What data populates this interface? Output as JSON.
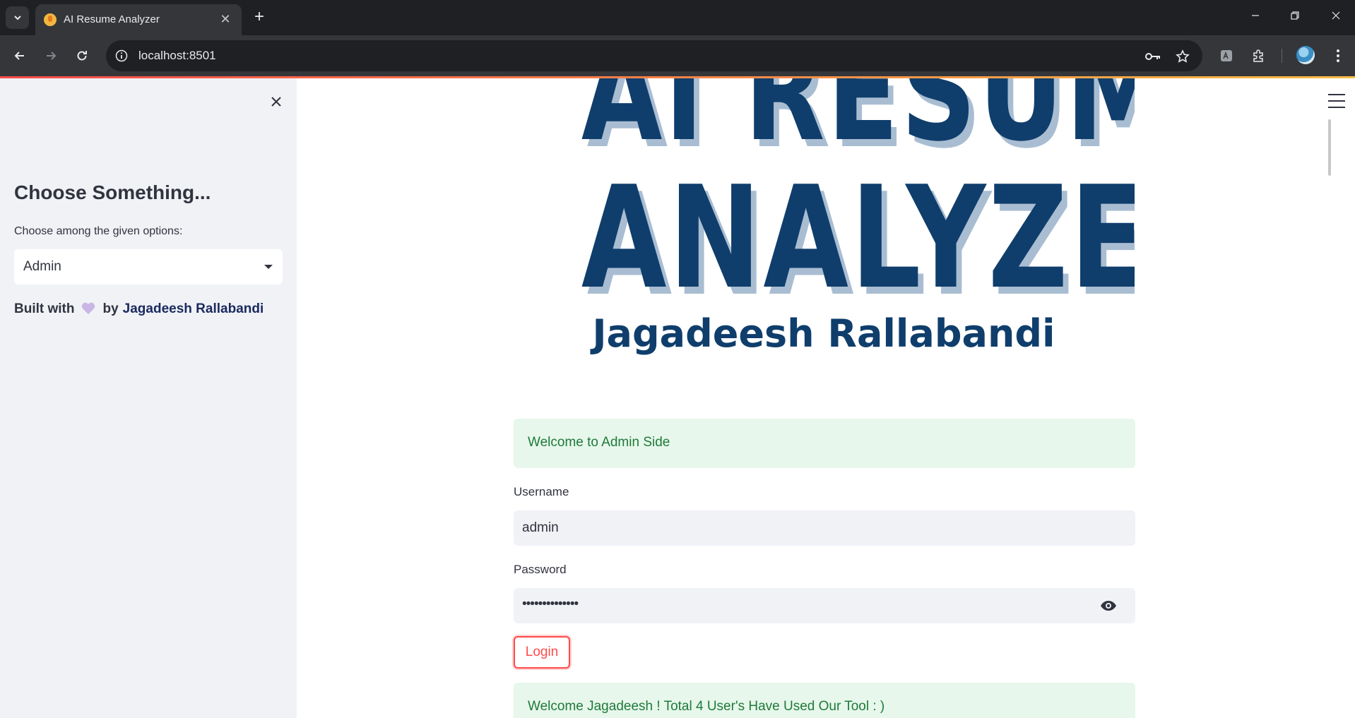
{
  "browser": {
    "tab_title": "AI Resume Analyzer",
    "url": "localhost:8501"
  },
  "sidebar": {
    "heading": "Choose Something...",
    "select_label": "Choose among the given options:",
    "select_value": "Admin",
    "built_with": "Built with",
    "by": "by",
    "author": "Jagadeesh Rallabandi"
  },
  "banner": {
    "line1": "AI RESUME",
    "line2": "ANALYZER",
    "author": "Jagadeesh Rallabandi"
  },
  "main": {
    "welcome_alert": "Welcome to Admin Side",
    "username_label": "Username",
    "username_value": "admin",
    "password_label": "Password",
    "password_value": "••••••••••••••",
    "login_label": "Login",
    "success_alert": "Welcome Jagadeesh ! Total 4 User's Have Used Our Tool : )"
  },
  "colors": {
    "accent": "#ff4b4b",
    "banner_blue": "#0f3e6c",
    "success_bg": "#e7f7eb",
    "success_text": "#1f7a3a",
    "sidebar_bg": "#f0f2f6"
  },
  "icons": [
    "tab-search-icon",
    "close-icon",
    "plus-icon",
    "minimize-icon",
    "restore-icon",
    "back-icon",
    "forward-icon",
    "reload-icon",
    "info-icon",
    "key-icon",
    "star-icon",
    "extension-icon",
    "puzzle-icon",
    "more-vert-icon",
    "menu-icon",
    "eye-icon",
    "heart-icon"
  ]
}
